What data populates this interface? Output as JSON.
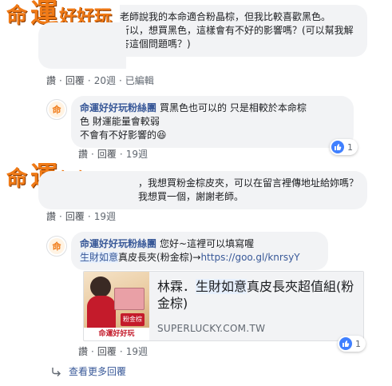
{
  "brand": {
    "big1": "命",
    "big2": "運",
    "small": "好好玩"
  },
  "comments": [
    {
      "text": "老師說我的本命適合粉晶棕，但我比較喜歡黑色。\n所以，想買黑色，這樣會有不好的影響嗎？(可以幫我解答這個問題嗎？)",
      "actions": {
        "like": "讚",
        "reply": "回覆",
        "time": "20週",
        "edited": "已編輯"
      }
    },
    {
      "author": "命運好好玩粉絲團",
      "text": "買黑色也可以的 只是相較於本命棕色 財運能量會較弱\n不會有不好影響的",
      "emoji": "😆",
      "actions": {
        "like": "讚",
        "reply": "回覆",
        "time": "19週"
      },
      "reaction_count": "1"
    },
    {
      "text": "，我想買粉金棕皮夾，可以在留言裡傳地址給妳嗎？我想買一個，謝謝老師。",
      "actions": {
        "like": "讚",
        "reply": "回覆",
        "time": "19週"
      }
    },
    {
      "author": "命運好好玩粉絲團",
      "text_before": "您好~這裡可以填寫喔",
      "tag": "生財如意",
      "text_after": "真皮長夾(粉金棕)→",
      "link": "https://goo.gl/knrsyY",
      "actions": {
        "like": "讚",
        "reply": "回覆",
        "time": "19週"
      },
      "reaction_count": "1"
    }
  ],
  "card": {
    "title_before": "林霖．",
    "title_hl": "生財如意",
    "title_after": "真皮長夾超值組(粉金棕)",
    "domain": "SUPERLUCKY.COM.TW",
    "image_badge": "粉金棕",
    "image_brand": "命運好好玩"
  },
  "more_replies": "查看更多回覆"
}
